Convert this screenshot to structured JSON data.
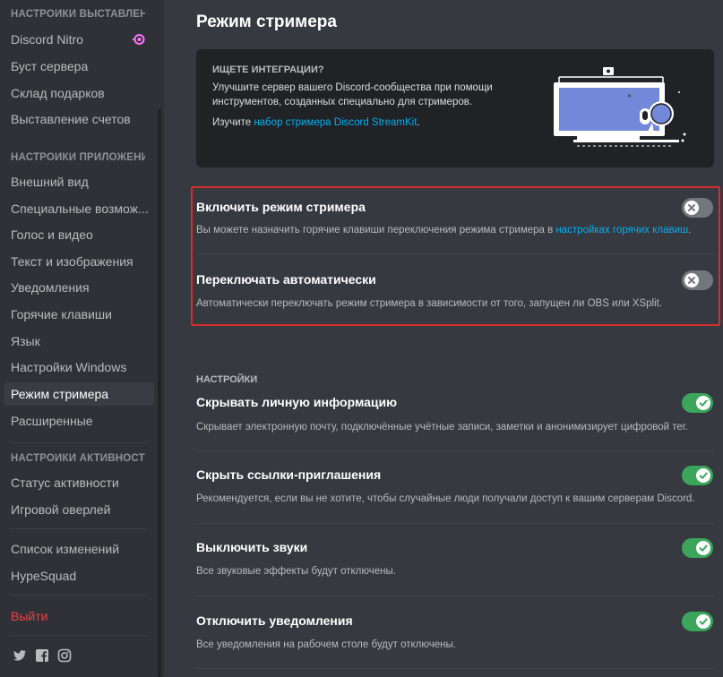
{
  "sidebar": {
    "sections": [
      {
        "header": "НАСТРОЙКИ ВЫСТАВЛЕН...",
        "items": [
          "Discord Nitro",
          "Буст сервера",
          "Склад подарков",
          "Выставление счетов"
        ]
      },
      {
        "header": "НАСТРОЙКИ ПРИЛОЖЕНИЯ",
        "items": [
          "Внешний вид",
          "Специальные возмож...",
          "Голос и видео",
          "Текст и изображения",
          "Уведомления",
          "Горячие клавиши",
          "Язык",
          "Настройки Windows",
          "Режим стримера",
          "Расширенные"
        ]
      },
      {
        "header": "НАСТРОЙКИ АКТИВНОСТИ",
        "items": [
          "Статус активности",
          "Игровой оверлей"
        ]
      }
    ],
    "extra_items": [
      "Список изменений",
      "HypeSquad"
    ],
    "logout": "Выйти",
    "active_item": "Режим стримера",
    "social_icons": [
      "twitter-icon",
      "facebook-icon",
      "instagram-icon"
    ]
  },
  "page": {
    "title": "Режим стримера",
    "promo": {
      "title": "ИЩЕТЕ ИНТЕГРАЦИИ?",
      "description": "Улучшите сервер вашего Discord-сообщества при помощи инструментов, созданных специально для стримеров.",
      "link_prefix": "Изучите ",
      "link_text": "набор стримера Discord StreamKit",
      "link_suffix": "."
    },
    "main_settings": [
      {
        "title": "Включить режим стримера",
        "desc": "Вы можете назначить горячие клавиши переключения режима стримера в ",
        "link": "настройках горячих клавиш",
        "desc_suffix": ".",
        "enabled": false
      },
      {
        "title": "Переключать автоматически",
        "desc": "Автоматически переключать режим стримера в зависимости от того, запущен ли OBS или XSplit.",
        "enabled": false
      }
    ],
    "section_label": "НАСТРОЙКИ",
    "settings": [
      {
        "title": "Скрывать личную информацию",
        "desc": "Скрывает электронную почту, подключённые учётные записи, заметки и анонимизирует цифровой тег.",
        "enabled": true
      },
      {
        "title": "Скрыть ссылки-приглашения",
        "desc": "Рекомендуется, если вы не хотите, чтобы случайные люди получали доступ к вашим серверам Discord.",
        "enabled": true
      },
      {
        "title": "Выключить звуки",
        "desc": "Все звуковые эффекты будут отключены.",
        "enabled": true
      },
      {
        "title": "Отключить уведомления",
        "desc": "Все уведомления на рабочем столе будут отключены.",
        "enabled": true
      }
    ]
  },
  "colors": {
    "accent_green": "#3ba55c",
    "link": "#00b0f4",
    "danger": "#ed4245",
    "highlight_border": "#d32f2f"
  }
}
